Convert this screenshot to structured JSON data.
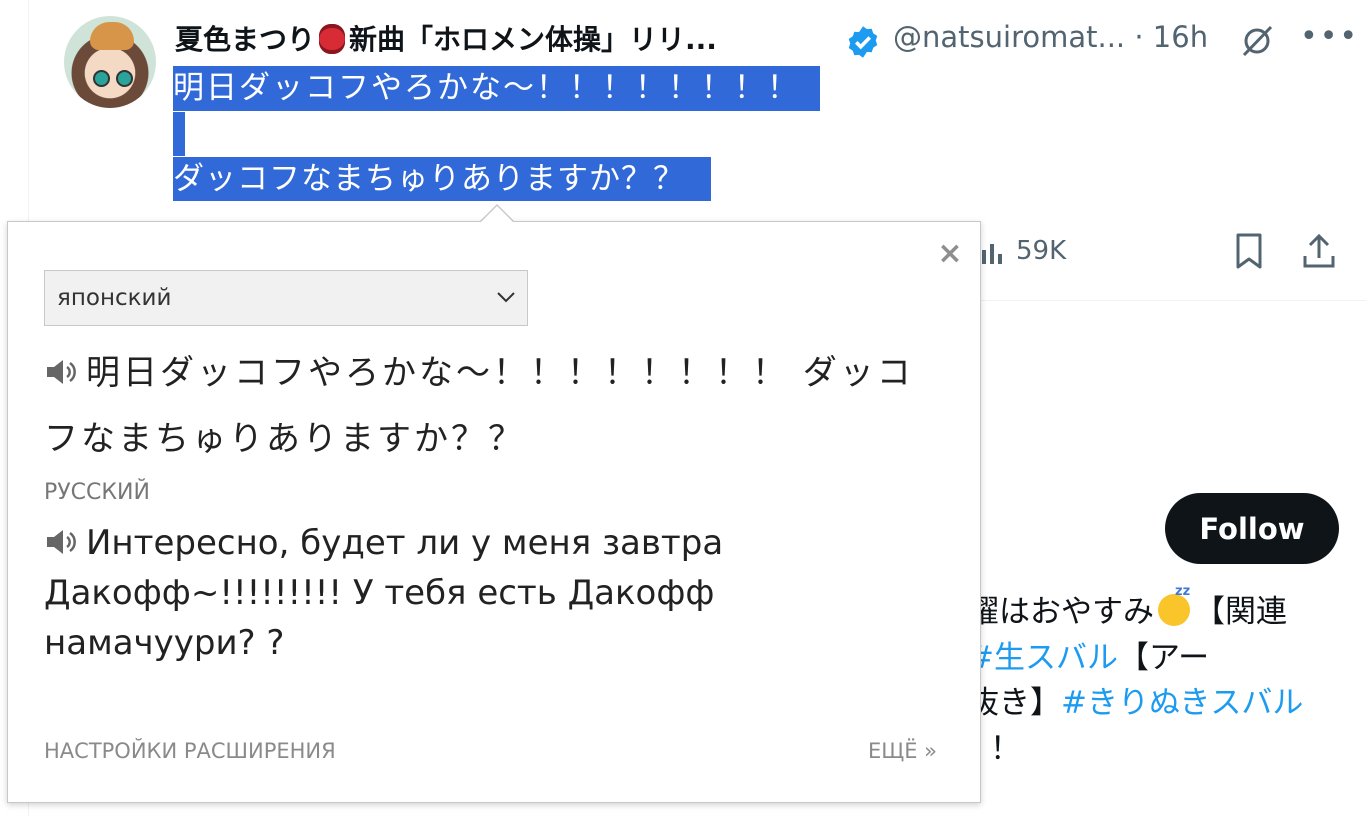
{
  "tweet": {
    "display_name_part1": "夏色まつり",
    "display_name_part2": "新曲「ホロメン体操」リリ...",
    "handle": "@natsuiromat...",
    "time": "· 16h",
    "text_line1": "明日ダッコフやろかな〜！！！！！！！！",
    "text_line3": "ダッコフなまちゅりありますか？？",
    "views": "59K"
  },
  "profile_card": {
    "follow_label": "Follow",
    "bio_line1_a": "曜はおやすみ",
    "bio_line1_b": "【関連",
    "bio_line2_tag": "#生スバル",
    "bio_line2_b": "【アー",
    "bio_line3_a": "抜き】",
    "bio_line3_tag": "#きりぬきスバル",
    "bio_line4": "！"
  },
  "translator": {
    "source_language": "японский",
    "source_text": "明日ダッコフやろかな〜！！！！！！！！ ダッコフなまちゅりありますか？？",
    "target_language": "РУССКИЙ",
    "target_text": "Интересно, будет ли у меня завтра Дакофф~!!!!!!!!! У тебя есть Дакофф намачуури? ?",
    "close_label": "×",
    "settings_label": "НАСТРОЙКИ РАСШИРЕНИЯ",
    "more_label": "ЕЩЁ »"
  },
  "colors": {
    "selection": "#3169d8",
    "link": "#1d9bf0",
    "follow_bg": "#0f1419",
    "verified": "#1d9bf0"
  },
  "icons": [
    "verified-icon",
    "grok-icon",
    "more-icon",
    "views-icon",
    "bookmark-icon",
    "share-icon",
    "close-icon",
    "chevron-down-icon",
    "speaker-icon"
  ]
}
